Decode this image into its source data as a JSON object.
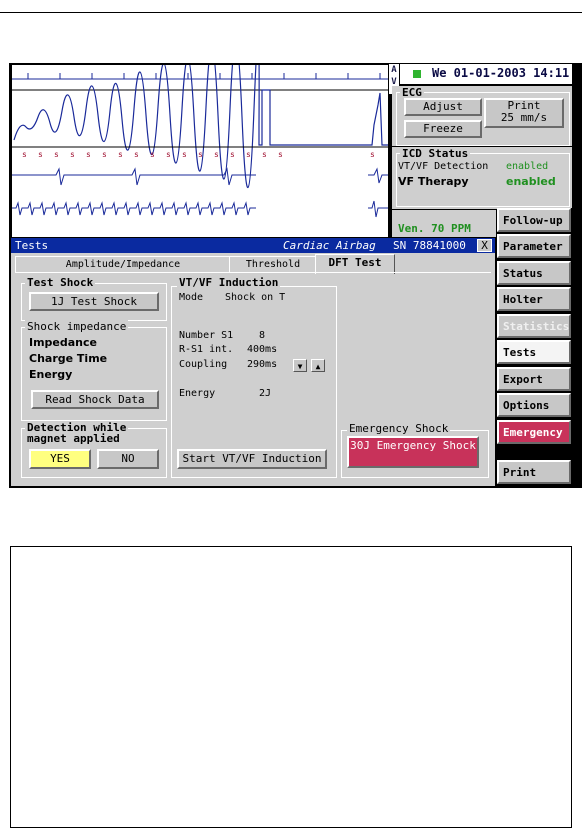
{
  "header": {
    "av_label": "A\nV",
    "datetime": "We 01-01-2003 14:11"
  },
  "ecg_panel": {
    "title": "ECG",
    "adjust": "Adjust",
    "freeze": "Freeze",
    "print_line1": "Print",
    "print_line2": "25 mm/s"
  },
  "icd_status": {
    "title": "ICD Status",
    "rows": [
      {
        "label": "VT/VF Detection",
        "value": "enabled"
      },
      {
        "label": "VF Therapy",
        "value": "enabled"
      }
    ]
  },
  "rate": "Ven.  70 PPM",
  "colors": {
    "accent_green": "#209020",
    "title_blue": "#0a2aa0",
    "emergency": "#c8325a",
    "yes_yellow": "#ffff80"
  },
  "menu": {
    "items": [
      {
        "label": "Follow-up",
        "state": "normal"
      },
      {
        "label": "Parameter",
        "state": "normal"
      },
      {
        "label": "Status",
        "state": "normal"
      },
      {
        "label": "Holter",
        "state": "normal"
      },
      {
        "label": "Statistics",
        "state": "disabled"
      },
      {
        "label": "Tests",
        "state": "active"
      },
      {
        "label": "Export",
        "state": "normal"
      },
      {
        "label": "Options",
        "state": "normal"
      },
      {
        "label": "Emergency",
        "state": "emergency"
      },
      {
        "label": "Print",
        "state": "normal"
      }
    ]
  },
  "window": {
    "title": "Tests",
    "device": "Cardiac Airbag",
    "serial": "SN 78841000",
    "close": "X",
    "tabs": [
      "Amplitude/Impedance",
      "Threshold",
      "DFT Test"
    ]
  },
  "test_shock": {
    "title": "Test Shock",
    "button": "1J Test Shock"
  },
  "shock_impedance": {
    "title": "Shock impedance",
    "rows": [
      "Impedance",
      "Charge Time",
      "Energy"
    ],
    "button": "Read Shock Data"
  },
  "detection": {
    "title_line1": "Detection while",
    "title_line2": "magnet applied",
    "yes": "YES",
    "no": "NO"
  },
  "induction": {
    "title": "VT/VF Induction",
    "mode_label": "Mode",
    "mode_value": "Shock on T",
    "number_label": "Number S1",
    "number_value": "8",
    "rs1_label": "R-S1 int.",
    "rs1_value": "400ms",
    "coupling_label": "Coupling",
    "coupling_value": "290ms",
    "energy_label": "Energy",
    "energy_value": "2J",
    "button": "Start VT/VF Induction"
  },
  "emergency_shock": {
    "title": "Emergency Shock",
    "button": "30J Emergency Shock"
  }
}
